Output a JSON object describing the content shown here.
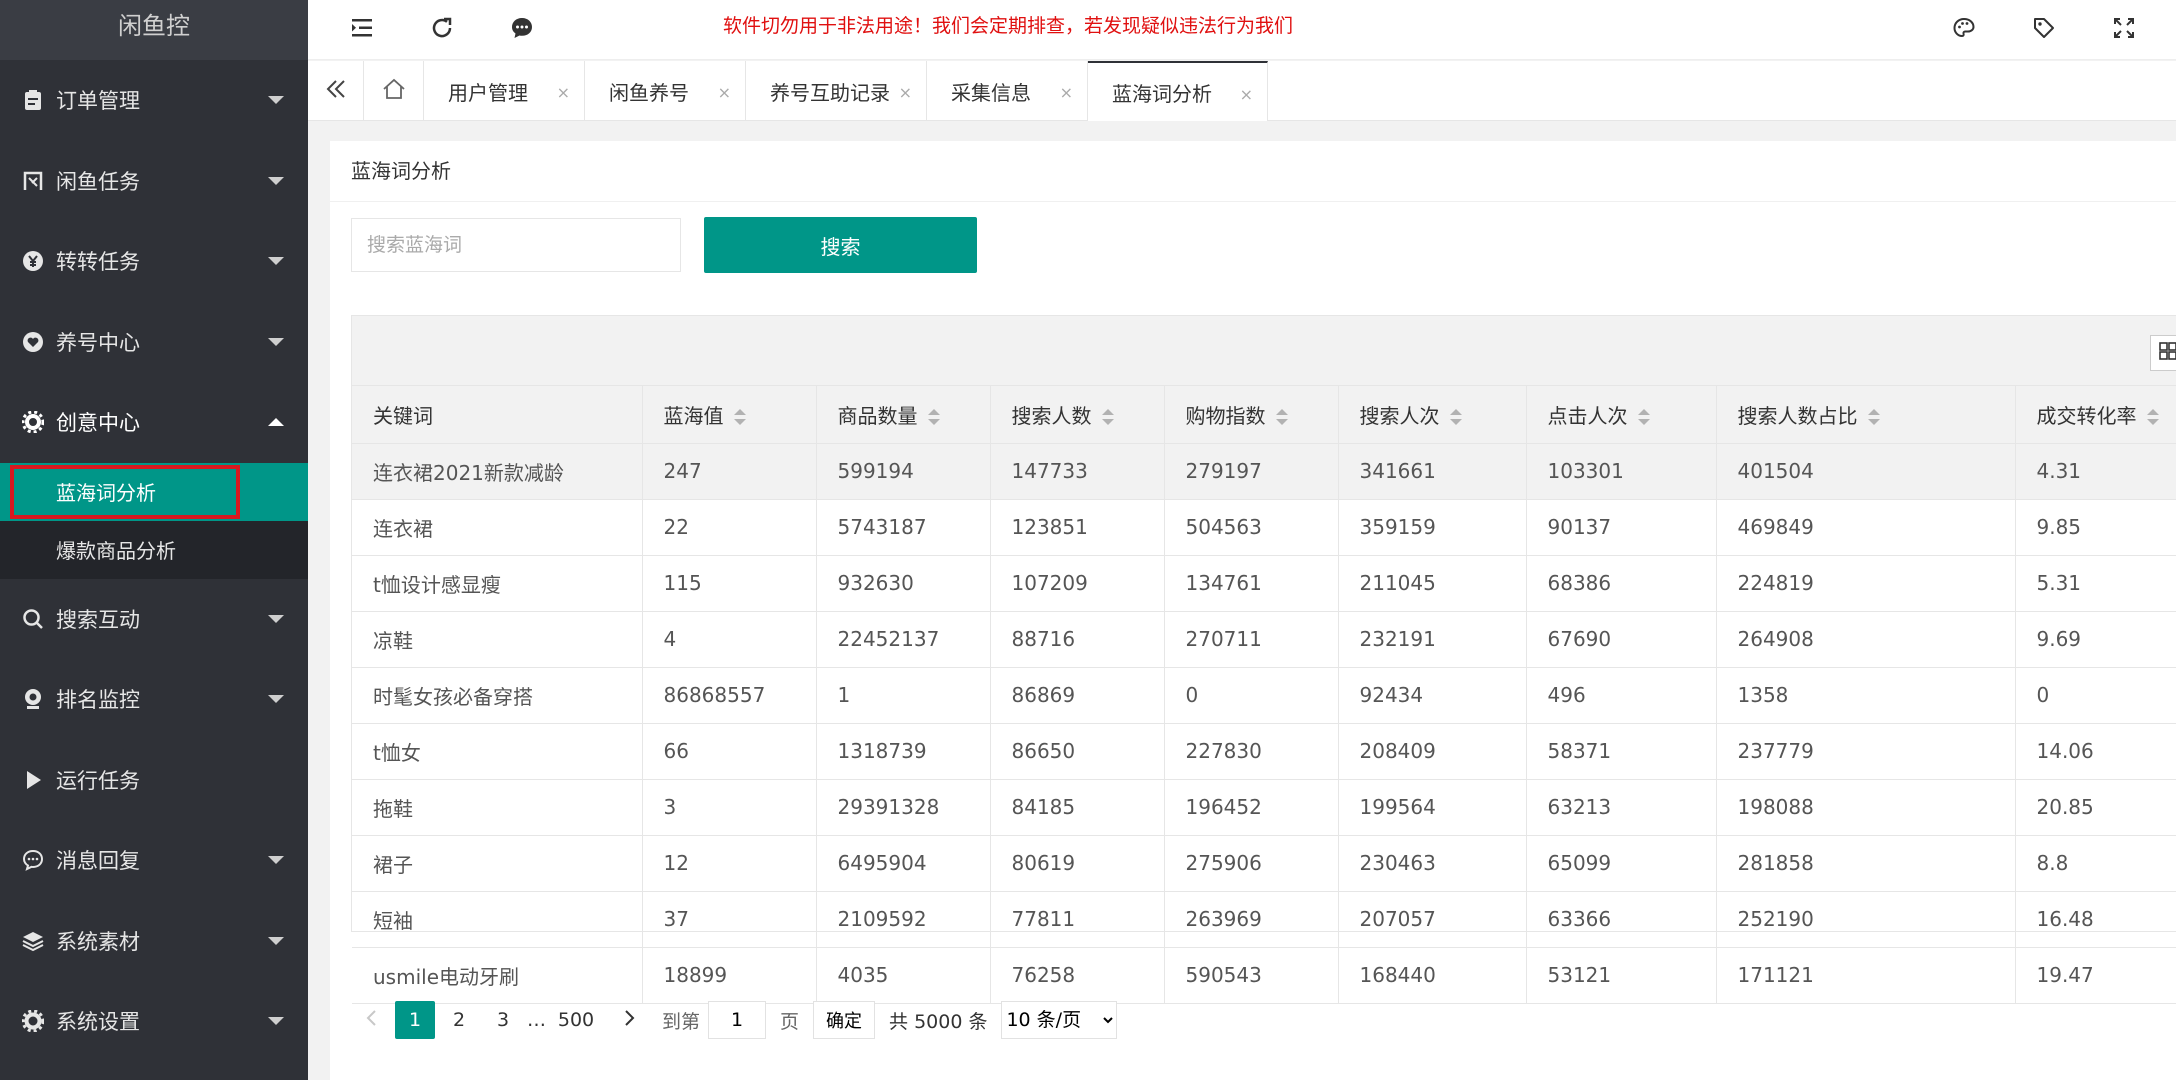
{
  "sidebar": {
    "logo": "闲鱼控",
    "items": [
      {
        "label": "订单管理",
        "icon": "clipboard-icon"
      },
      {
        "label": "闲鱼任务",
        "icon": "fish-icon"
      },
      {
        "label": "转转任务",
        "icon": "yuan-icon"
      },
      {
        "label": "养号中心",
        "icon": "heart-icon"
      },
      {
        "label": "创意中心",
        "icon": "gear-icon"
      },
      {
        "label": "搜索互动",
        "icon": "search-icon"
      },
      {
        "label": "排名监控",
        "icon": "monitor-icon"
      },
      {
        "label": "运行任务",
        "icon": "play-icon"
      },
      {
        "label": "消息回复",
        "icon": "chat-icon"
      },
      {
        "label": "系统素材",
        "icon": "layers-icon"
      },
      {
        "label": "系统设置",
        "icon": "settings-icon"
      }
    ],
    "sub_items": [
      {
        "label": "蓝海词分析"
      },
      {
        "label": "爆款商品分析"
      }
    ]
  },
  "header": {
    "notice": "软件切勿用于非法用途！我们会定期排查，若发现疑似违法行为我们"
  },
  "tabs": [
    {
      "label": "用户管理"
    },
    {
      "label": "闲鱼养号"
    },
    {
      "label": "养号互助记录"
    },
    {
      "label": "采集信息"
    },
    {
      "label": "蓝海词分析"
    }
  ],
  "tab_close": "×",
  "card": {
    "title": "蓝海词分析",
    "search_placeholder": "搜索蓝海词",
    "search_button": "搜索"
  },
  "table": {
    "columns": [
      "关键词",
      "蓝海值",
      "商品数量",
      "搜索人数",
      "购物指数",
      "搜索人次",
      "点击人次",
      "搜索人数占比",
      "成交转化率"
    ],
    "rows": [
      [
        "连衣裙2021新款减龄",
        "247",
        "599194",
        "147733",
        "279197",
        "341661",
        "103301",
        "401504",
        "4.31"
      ],
      [
        "连衣裙",
        "22",
        "5743187",
        "123851",
        "504563",
        "359159",
        "90137",
        "469849",
        "9.85"
      ],
      [
        "t恤设计感显瘦",
        "115",
        "932630",
        "107209",
        "134761",
        "211045",
        "68386",
        "224819",
        "5.31"
      ],
      [
        "凉鞋",
        "4",
        "22452137",
        "88716",
        "270711",
        "232191",
        "67690",
        "264908",
        "9.69"
      ],
      [
        "时髦女孩必备穿搭",
        "86868557",
        "1",
        "86869",
        "0",
        "92434",
        "496",
        "1358",
        "0"
      ],
      [
        "t恤女",
        "66",
        "1318739",
        "86650",
        "227830",
        "208409",
        "58371",
        "237779",
        "14.06"
      ],
      [
        "拖鞋",
        "3",
        "29391328",
        "84185",
        "196452",
        "199564",
        "63213",
        "198088",
        "20.85"
      ],
      [
        "裙子",
        "12",
        "6495904",
        "80619",
        "275906",
        "230463",
        "65099",
        "281858",
        "8.8"
      ],
      [
        "短袖",
        "37",
        "2109592",
        "77811",
        "263969",
        "207057",
        "63366",
        "252190",
        "16.48"
      ],
      [
        "usmile电动牙刷",
        "18899",
        "4035",
        "76258",
        "590543",
        "168440",
        "53121",
        "171121",
        "19.47"
      ]
    ]
  },
  "pager": {
    "pages": [
      "1",
      "2",
      "3"
    ],
    "ellipsis": "…",
    "last": "500",
    "goto_label": "到第",
    "goto_value": "1",
    "page_unit": "页",
    "confirm": "确定",
    "total": "共 5000 条",
    "page_size": "10 条/页"
  },
  "colors": {
    "accent": "#009688",
    "sidebar": "#2f3137",
    "notice": "#e01010",
    "highlight": "#d7191f"
  }
}
